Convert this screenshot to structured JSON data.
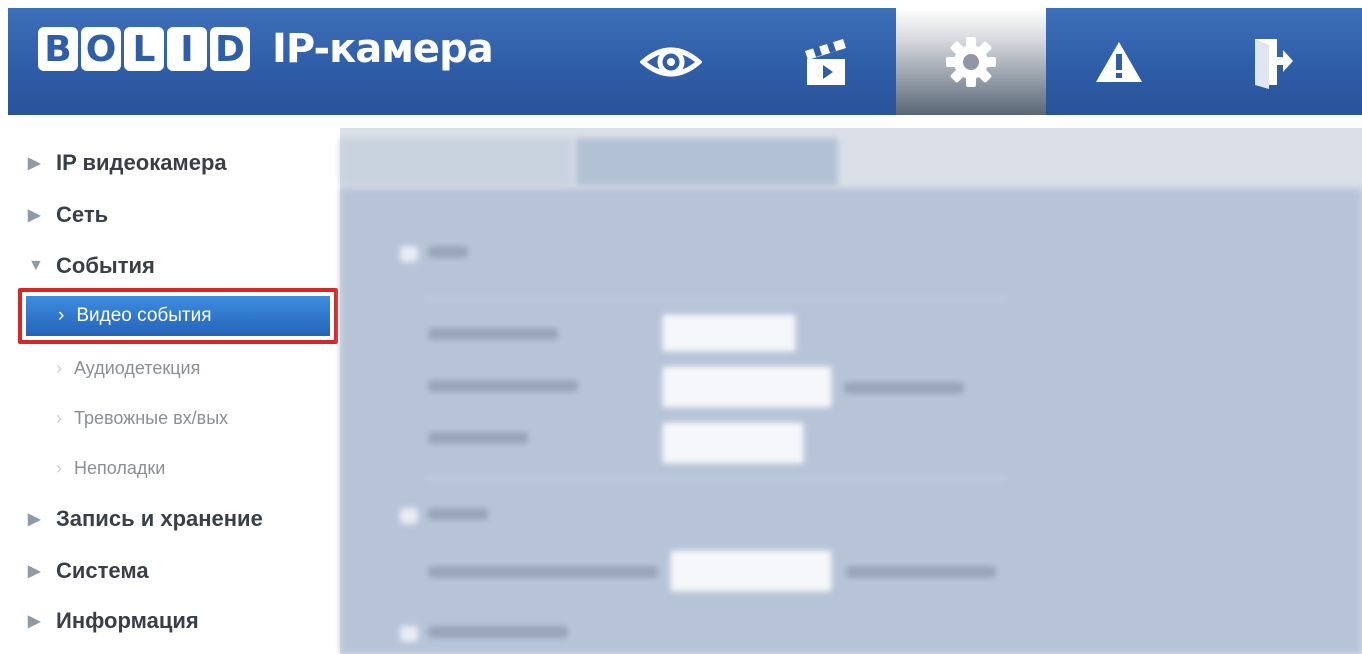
{
  "header": {
    "logo_letters": [
      "B",
      "O",
      "L",
      "I",
      "D"
    ],
    "title": "IP-камера",
    "nav": [
      {
        "name": "live-view",
        "icon": "eye-icon",
        "active": false
      },
      {
        "name": "playback",
        "icon": "clapperboard-icon",
        "active": false
      },
      {
        "name": "settings",
        "icon": "gear-icon",
        "active": true
      },
      {
        "name": "alarm",
        "icon": "warning-icon",
        "active": false
      },
      {
        "name": "logout",
        "icon": "exit-door-icon",
        "active": false
      }
    ]
  },
  "sidebar": {
    "items": [
      {
        "label": "IP видеокамера",
        "expanded": false
      },
      {
        "label": "Сеть",
        "expanded": false
      },
      {
        "label": "События",
        "expanded": true
      },
      {
        "label": "Запись и хранение",
        "expanded": false
      },
      {
        "label": "Система",
        "expanded": false
      },
      {
        "label": "Информация",
        "expanded": false
      }
    ],
    "subitems": [
      {
        "label": "Видео события",
        "active": true
      },
      {
        "label": "Аудиодетекция",
        "active": false
      },
      {
        "label": "Тревожные вх/вых",
        "active": false
      },
      {
        "label": "Неполадки",
        "active": false
      }
    ]
  },
  "colors": {
    "header_blue": "#2f5ea8",
    "active_item_blue": "#2363b8",
    "highlight_red": "#d62727",
    "content_bg": "#b7c4d8"
  }
}
